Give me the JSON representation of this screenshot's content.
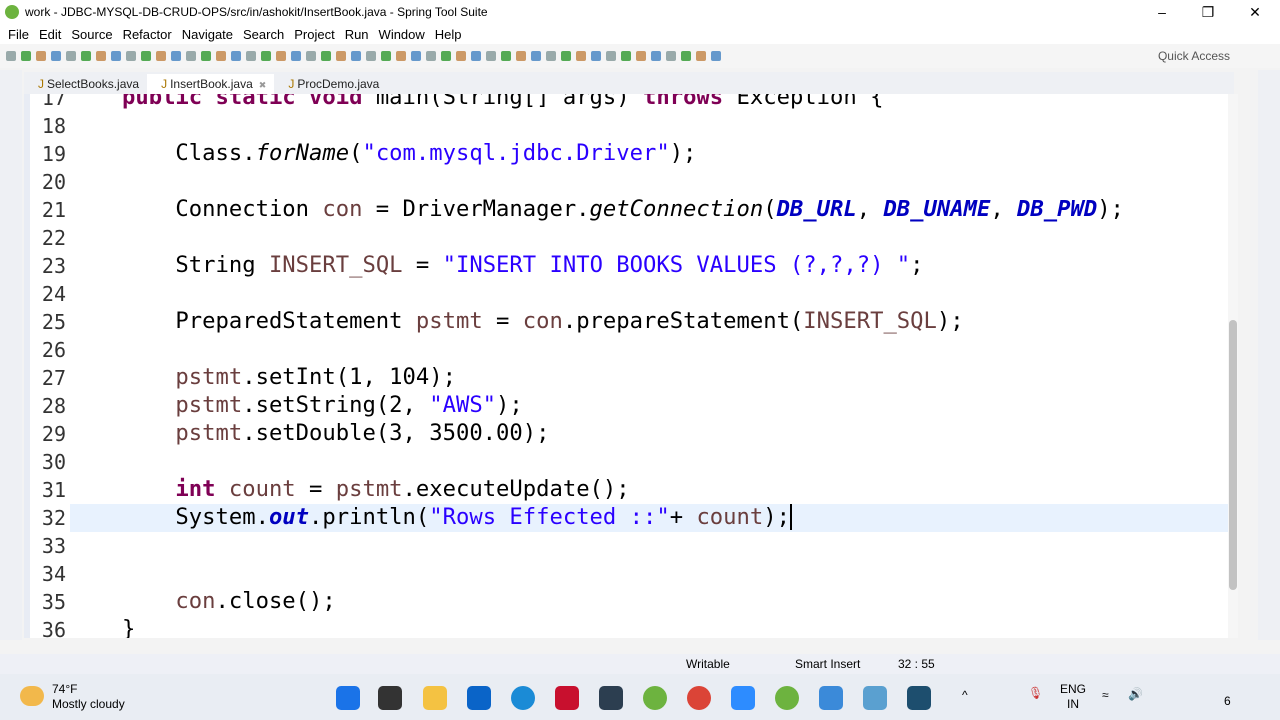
{
  "window": {
    "title": "work - JDBC-MYSQL-DB-CRUD-OPS/src/in/ashokit/InsertBook.java - Spring Tool Suite"
  },
  "menu": [
    "File",
    "Edit",
    "Source",
    "Refactor",
    "Navigate",
    "Search",
    "Project",
    "Run",
    "Window",
    "Help"
  ],
  "toolbar": {
    "quick_access": "Quick Access"
  },
  "tabs": [
    {
      "label": "SelectBooks.java",
      "active": false
    },
    {
      "label": "InsertBook.java",
      "active": true
    },
    {
      "label": "ProcDemo.java",
      "active": false
    }
  ],
  "code": {
    "current_line": 32,
    "lines": [
      {
        "n": "17",
        "t": [
          [
            "kw",
            "public"
          ],
          [
            "",
            ""
          ],
          [
            "",
            ""
          ],
          [
            "kw",
            " static"
          ],
          [
            "kw",
            " void"
          ],
          [
            "",
            " main(String[] args) "
          ],
          [
            "kw",
            "throws"
          ],
          [
            "",
            " Exception {"
          ]
        ]
      },
      {
        "n": "18",
        "t": []
      },
      {
        "n": "19",
        "t": [
          [
            "",
            "    Class."
          ],
          [
            "it",
            "forName"
          ],
          [
            "",
            "("
          ],
          [
            "str",
            "\"com.mysql.jdbc.Driver\""
          ],
          [
            "",
            ");"
          ]
        ]
      },
      {
        "n": "20",
        "t": []
      },
      {
        "n": "21",
        "t": [
          [
            "",
            "    Connection "
          ],
          [
            "var",
            "con"
          ],
          [
            "",
            " = DriverManager."
          ],
          [
            "it",
            "getConnection"
          ],
          [
            "",
            "("
          ],
          [
            "fld",
            "DB_URL"
          ],
          [
            "",
            ", "
          ],
          [
            "fld",
            "DB_UNAME"
          ],
          [
            "",
            ", "
          ],
          [
            "fld",
            "DB_PWD"
          ],
          [
            "",
            ");"
          ]
        ]
      },
      {
        "n": "22",
        "t": []
      },
      {
        "n": "23",
        "t": [
          [
            "",
            "    String "
          ],
          [
            "var",
            "INSERT_SQL"
          ],
          [
            "",
            " = "
          ],
          [
            "str",
            "\"INSERT INTO BOOKS VALUES (?,?,?) \""
          ],
          [
            "",
            ";"
          ]
        ]
      },
      {
        "n": "24",
        "t": []
      },
      {
        "n": "25",
        "t": [
          [
            "",
            "    PreparedStatement "
          ],
          [
            "var",
            "pstmt"
          ],
          [
            "",
            " = "
          ],
          [
            "var",
            "con"
          ],
          [
            "",
            ".prepareStatement("
          ],
          [
            "var",
            "INSERT_SQL"
          ],
          [
            "",
            ");"
          ]
        ]
      },
      {
        "n": "26",
        "t": []
      },
      {
        "n": "27",
        "t": [
          [
            "var",
            "    pstmt"
          ],
          [
            "",
            ".setInt(1, 104);"
          ]
        ]
      },
      {
        "n": "28",
        "t": [
          [
            "var",
            "    pstmt"
          ],
          [
            "",
            ".setString(2, "
          ],
          [
            "str",
            "\"AWS\""
          ],
          [
            "",
            ");"
          ]
        ]
      },
      {
        "n": "29",
        "t": [
          [
            "var",
            "    pstmt"
          ],
          [
            "",
            ".setDouble(3, 3500.00);"
          ]
        ]
      },
      {
        "n": "30",
        "t": []
      },
      {
        "n": "31",
        "t": [
          [
            "kw",
            "    int"
          ],
          [
            "var",
            " count"
          ],
          [
            "",
            " = "
          ],
          [
            "var",
            "pstmt"
          ],
          [
            "",
            ".executeUpdate();"
          ]
        ]
      },
      {
        "n": "32",
        "t": [
          [
            "",
            "    System."
          ],
          [
            "fld",
            "out"
          ],
          [
            "",
            ".println("
          ],
          [
            "str",
            "\"Rows Effected ::\""
          ],
          [
            "",
            "+ "
          ],
          [
            "var",
            "count"
          ],
          [
            "",
            ");"
          ]
        ]
      },
      {
        "n": "33",
        "t": []
      },
      {
        "n": "34",
        "t": []
      },
      {
        "n": "35",
        "t": [
          [
            "var",
            "    con"
          ],
          [
            "",
            ".close();"
          ]
        ]
      },
      {
        "n": "36",
        "t": [
          [
            "",
            "}"
          ]
        ]
      }
    ]
  },
  "status": {
    "mode": "Writable",
    "insert": "Smart Insert",
    "position": "32 : 55"
  },
  "taskbar": {
    "temp": "74°F",
    "weather": "Mostly cloudy",
    "lang1": "ENG",
    "lang2": "IN",
    "time": "6"
  },
  "colors": {
    "keyword": "#7f0055",
    "string": "#2a00ff",
    "field": "#0000c0",
    "variable": "#6a3e3e",
    "current_line": "#e8f2fe"
  }
}
